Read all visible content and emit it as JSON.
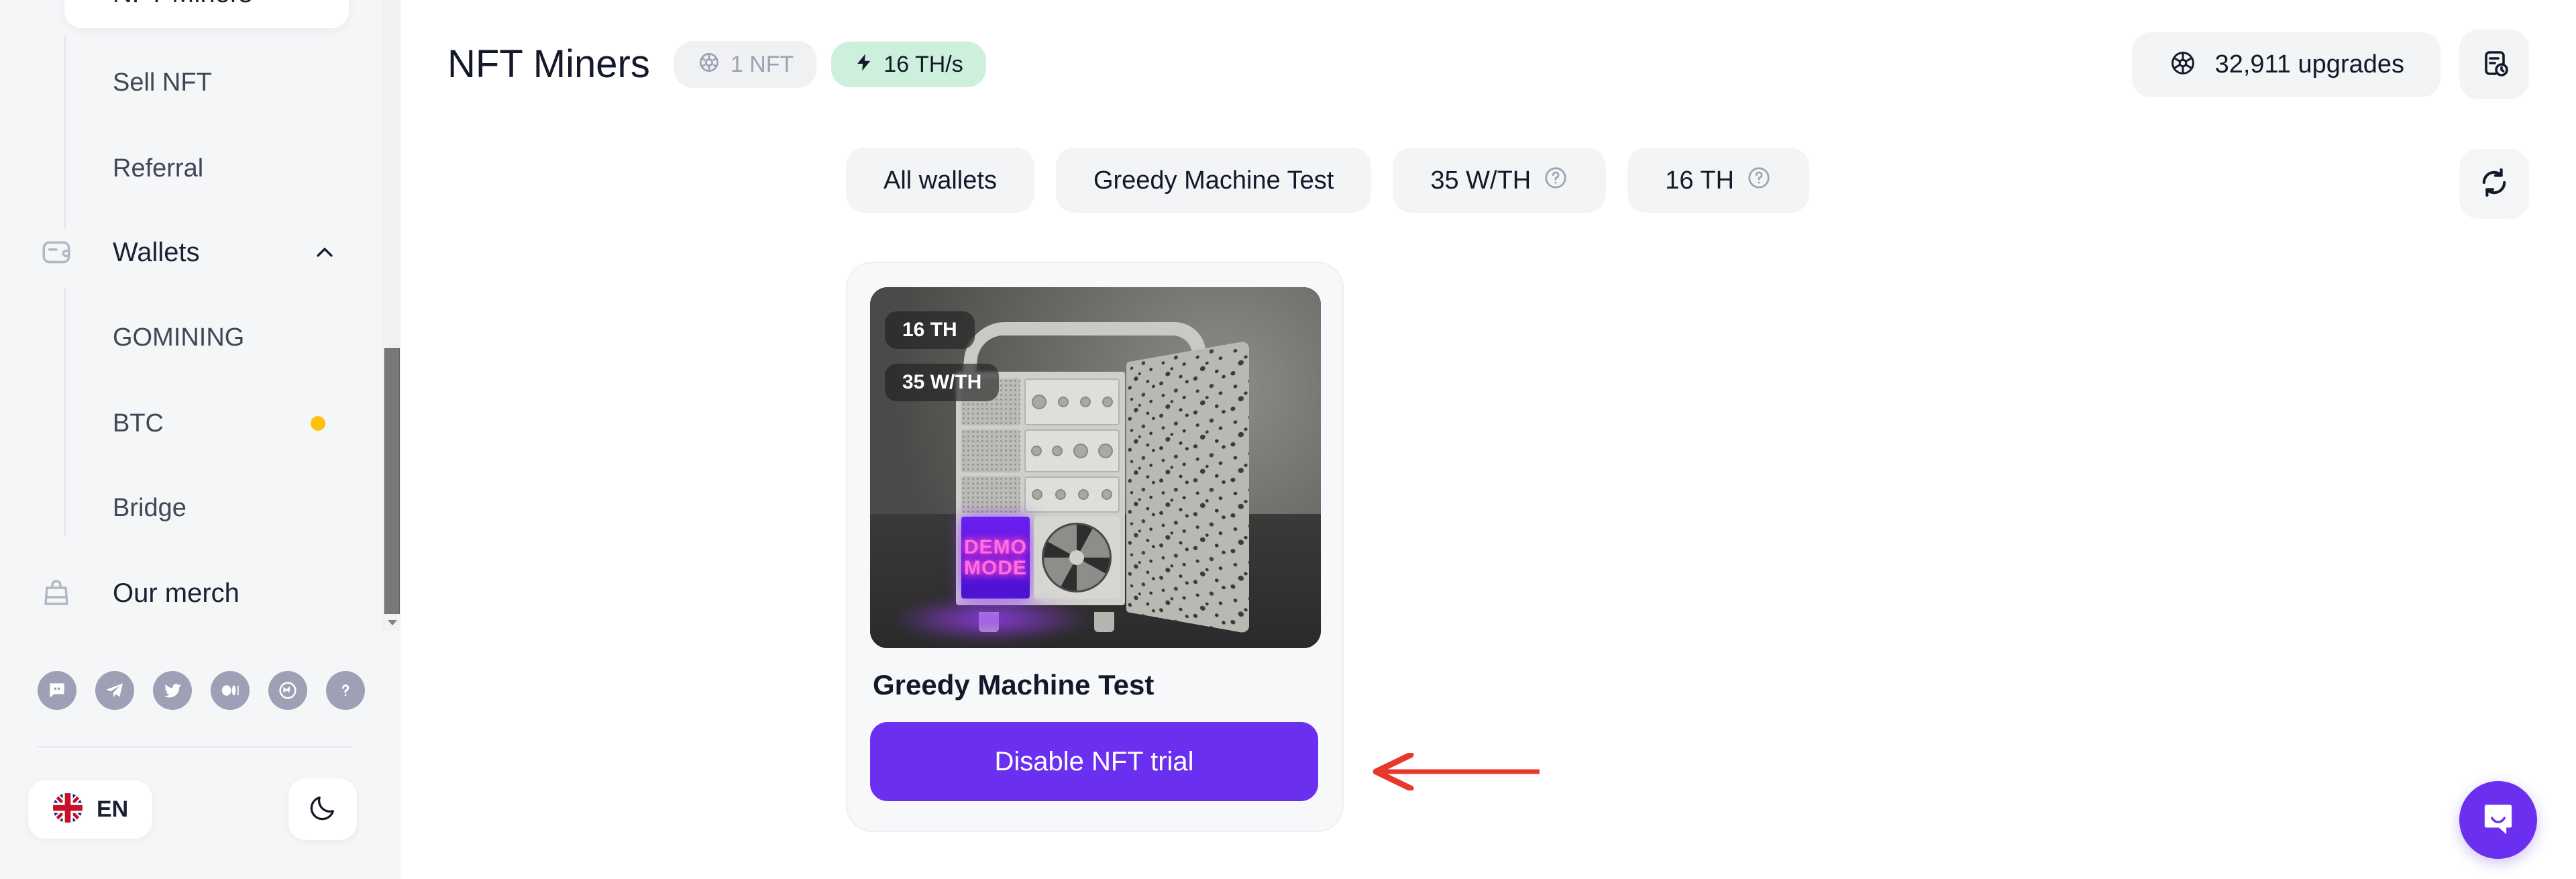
{
  "sidebar": {
    "active_item": {
      "label": "NFT Miners",
      "name": "sidebar-item-nft-miners"
    },
    "sub_items": [
      {
        "label": "Sell NFT"
      },
      {
        "label": "Referral"
      }
    ],
    "groups": [
      {
        "label": "Wallets",
        "icon": "wallet-icon",
        "expanded": true,
        "chevron": "chevron-up-icon"
      },
      {
        "label": "Our merch",
        "icon": "shopping-bag-icon",
        "expanded": false
      }
    ],
    "wallet_items": [
      {
        "label": "GOMINING",
        "badge": false
      },
      {
        "label": "BTC",
        "badge": true,
        "badge_color": "#FFC107"
      },
      {
        "label": "Bridge",
        "badge": false
      }
    ],
    "social": [
      {
        "name": "discord-icon"
      },
      {
        "name": "telegram-icon"
      },
      {
        "name": "twitter-icon"
      },
      {
        "name": "medium-icon"
      },
      {
        "name": "coinmarketcap-icon"
      },
      {
        "name": "help-icon"
      }
    ],
    "language": {
      "label": "EN",
      "flag": "uk-flag-icon"
    },
    "theme_toggle": {
      "icon": "moon-icon"
    },
    "scrollbar": {
      "name": "sidebar-scrollbar"
    }
  },
  "header": {
    "title": "NFT Miners",
    "nft_count_chip": {
      "label": "1 NFT",
      "icon": "nft-wheel-icon"
    },
    "hashrate_chip": {
      "label": "16 TH/s",
      "icon": "lightning-bolt-icon",
      "color": "#cdf0dd"
    },
    "upgrades_pill": {
      "label": "32,911 upgrades",
      "icon": "nft-wheel-icon"
    },
    "history_button": {
      "icon": "document-clock-icon"
    }
  },
  "filters": [
    {
      "label": "All wallets",
      "help": false
    },
    {
      "label": "Greedy Machine Test",
      "help": false
    },
    {
      "label": "35 W/TH",
      "help": true
    },
    {
      "label": "16 TH",
      "help": true
    }
  ],
  "refresh_button": {
    "icon": "refresh-icon"
  },
  "nft_card": {
    "title": "Greedy Machine Test",
    "badges": [
      "16 TH",
      "35 W/TH"
    ],
    "screen_text_line1": "DEMO",
    "screen_text_line2": "MODE",
    "action_button": {
      "label": "Disable NFT trial",
      "color": "#6b2ff0"
    }
  },
  "annotation": {
    "name": "red-arrow-annotation",
    "color": "#e8372c"
  },
  "intercom": {
    "name": "intercom-launcher",
    "color": "#6b2ff0"
  }
}
